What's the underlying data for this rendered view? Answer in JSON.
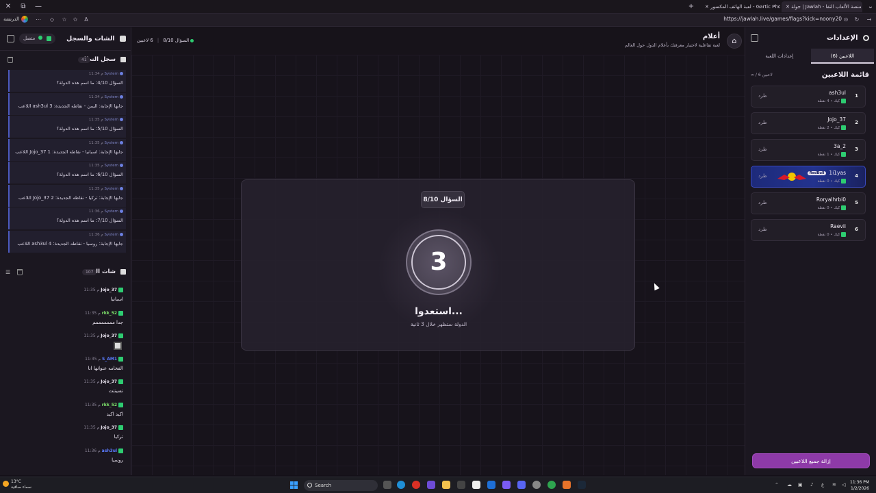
{
  "browser": {
    "tabs": [
      {
        "label": "جولة | Jawlah - منصة الألعاب التفا",
        "active": true
      },
      {
        "label": "لعبة الهاتف المكسور - Gartic Phone",
        "active": false
      }
    ],
    "url": "https://jawlah.live/games/flags?kick=noony20",
    "profile_label": "الدرنشة"
  },
  "left_panel": {
    "title": "الشات والسجل",
    "status": "متصل",
    "system_log": {
      "title": "سجل النظام",
      "count": "41",
      "items": [
        {
          "sender": "System",
          "time": "11:34 م",
          "text": "السؤال 4/10: ما اسم هذه الدولة؟"
        },
        {
          "sender": "System",
          "time": "11:34 م",
          "text": "اللاعب ash3ul جابها الإجابة: اليمن - نقاطه الجديدة: 3"
        },
        {
          "sender": "System",
          "time": "11:35 م",
          "text": "السؤال 5/10: ما اسم هذه الدولة؟"
        },
        {
          "sender": "System",
          "time": "11:35 م",
          "text": "اللاعب Jojo_37 جابها الإجابة: اسبانيا - نقاطه الجديدة: 1"
        },
        {
          "sender": "System",
          "time": "11:35 م",
          "text": "السؤال 6/10: ما اسم هذه الدولة؟"
        },
        {
          "sender": "System",
          "time": "11:35 م",
          "text": "اللاعب Jojo_37 جابها الإجابة: تركيا - نقاطه الجديدة: 2"
        },
        {
          "sender": "System",
          "time": "11:36 م",
          "text": "السؤال 7/10: ما اسم هذه الدولة؟"
        },
        {
          "sender": "System",
          "time": "11:36 م",
          "text": "اللاعب ash3ul جابها الإجابة: روسيا - نقاطه الجديدة: 4"
        }
      ]
    },
    "chat": {
      "title": "شات البث",
      "count": "107",
      "items": [
        {
          "user": "Jojo_37",
          "time": "11:35 م",
          "text": "اسبانيا",
          "color": "#e8e2ee"
        },
        {
          "user": "rkk_52",
          "time": "11:35 م",
          "text": "جدا مممممممم",
          "color": "#7ee36b"
        },
        {
          "user": "Jojo_37",
          "time": "11:35 م",
          "text": "",
          "color": "#e8e2ee"
        },
        {
          "user": "S_AM1",
          "time": "11:35 م",
          "text": "الفخامه عنوانها انا",
          "color": "#5b7cff"
        },
        {
          "user": "Jojo_37",
          "time": "11:35 م",
          "text": "تسيتتت",
          "color": "#e8e2ee"
        },
        {
          "user": "rkk_52",
          "time": "11:35 م",
          "text": "اكيد اكيد",
          "color": "#7ee36b"
        },
        {
          "user": "Jojo_37",
          "time": "11:35 م",
          "text": "تركيا",
          "color": "#e8e2ee"
        },
        {
          "user": "ash3ul",
          "time": "11:36 م",
          "text": "روسيا",
          "color": "#5b7cff"
        }
      ]
    }
  },
  "header": {
    "title": "أعلام",
    "subtitle": "لعبة تفاعلية لاختبار معرفتك بأعلام الدول حول العالم",
    "question_indicator": "السؤال 8/10",
    "players_indicator": "6 لاعبين"
  },
  "stage": {
    "question_label": "السؤال 8/10",
    "countdown": "3",
    "heading": "استعدوا...",
    "subtext": "الدولة ستظهر خلال 3 ثانية"
  },
  "right_panel": {
    "title": "الإعدادات",
    "tabs": [
      "اللاعبين (6)",
      "إعدادات اللعبة"
    ],
    "list_title": "قائمة اللاعبين",
    "list_count": "∞ / 6 لاعبين",
    "kick_label": "طرد",
    "players": [
      {
        "rank": "1",
        "name": "ash3ul",
        "stats": "كيك • 4 نقطة"
      },
      {
        "rank": "2",
        "name": "Jojo_37",
        "stats": "كيك • 2 نقطة"
      },
      {
        "rank": "3",
        "name": "3a_2",
        "stats": "كيك • 1 نقطة"
      },
      {
        "rank": "4",
        "name": "1i1yas",
        "stats": "كيك • 0 نقطة",
        "badge": "RedBull"
      },
      {
        "rank": "5",
        "name": "Roryalhrbi0",
        "stats": "كيك • 0 نقطة"
      },
      {
        "rank": "6",
        "name": "Raevii",
        "stats": "كيك • 0 نقطة"
      }
    ],
    "remove_all": "إزالة جميع اللاعبين"
  },
  "taskbar": {
    "weather_temp": "13°C",
    "weather_desc": "سماء صافية",
    "search_label": "Search",
    "time": "11:36 PM",
    "date": "1/2/2026",
    "lang": "ع"
  },
  "colors": {
    "accent": "#8e3aa8",
    "online": "#2ecc71",
    "system": "#6b7fe0"
  }
}
